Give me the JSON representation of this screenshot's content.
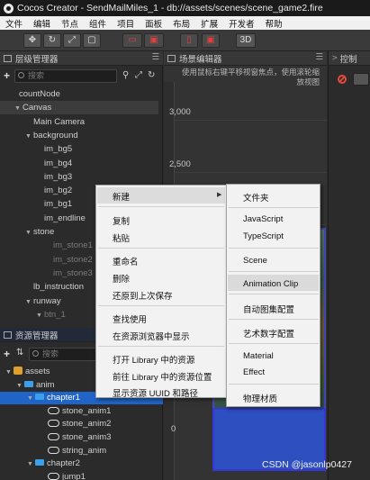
{
  "window": {
    "title": "Cocos Creator - SendMailMiles_1 - db://assets/scenes/scene_game2.fire"
  },
  "menu": [
    "文件",
    "编辑",
    "节点",
    "组件",
    "项目",
    "面板",
    "布局",
    "扩展",
    "开发者",
    "帮助"
  ],
  "toolbar": {
    "mode_3d": "3D"
  },
  "hierarchy": {
    "title": "层级管理器",
    "search_placeholder": "搜索",
    "items": [
      {
        "label": "countNode",
        "depth": 0,
        "arrow": "",
        "dim": false
      },
      {
        "label": "Canvas",
        "depth": 0,
        "arrow": "▼",
        "dim": false
      },
      {
        "label": "Main Camera",
        "depth": 1,
        "arrow": "",
        "dim": false
      },
      {
        "label": "background",
        "depth": 1,
        "arrow": "▼",
        "dim": false
      },
      {
        "label": "im_bg5",
        "depth": 2,
        "arrow": "",
        "dim": false
      },
      {
        "label": "im_bg4",
        "depth": 2,
        "arrow": "",
        "dim": false
      },
      {
        "label": "im_bg3",
        "depth": 2,
        "arrow": "",
        "dim": false
      },
      {
        "label": "im_bg2",
        "depth": 2,
        "arrow": "",
        "dim": false
      },
      {
        "label": "im_bg1",
        "depth": 2,
        "arrow": "",
        "dim": false
      },
      {
        "label": "im_endline",
        "depth": 2,
        "arrow": "",
        "dim": false
      },
      {
        "label": "stone",
        "depth": 1,
        "arrow": "▼",
        "dim": false
      },
      {
        "label": "im_stone1",
        "depth": 2,
        "arrow": "",
        "dim": true
      },
      {
        "label": "im_stone2",
        "depth": 2,
        "arrow": "",
        "dim": true
      },
      {
        "label": "im_stone3",
        "depth": 2,
        "arrow": "",
        "dim": true
      },
      {
        "label": "lb_instruction",
        "depth": 1,
        "arrow": "",
        "dim": false
      },
      {
        "label": "runway",
        "depth": 1,
        "arrow": "▼",
        "dim": false
      },
      {
        "label": "btn_1",
        "depth": 2,
        "arrow": "▼",
        "dim": true
      }
    ]
  },
  "scene": {
    "title": "场景编辑器",
    "hint_line1": "使用鼠标右键平移视窗焦点，使用滚轮缩",
    "hint_line2": "放视图",
    "y_labels": [
      "3,000",
      "2,500",
      "0"
    ]
  },
  "console": {
    "title": "控制"
  },
  "assets": {
    "title": "资源管理器",
    "search_placeholder": "搜索",
    "items": [
      {
        "label": "assets",
        "icon": "db",
        "arrow": "▼",
        "depth": 0,
        "selected": false
      },
      {
        "label": "anim",
        "icon": "folder",
        "arrow": "▼",
        "depth": 1,
        "selected": false
      },
      {
        "label": "chapter1",
        "icon": "folder",
        "arrow": "▼",
        "depth": 2,
        "selected": true
      },
      {
        "label": "stone_anim1",
        "icon": "anim",
        "arrow": "",
        "depth": 3,
        "selected": false
      },
      {
        "label": "stone_anim2",
        "icon": "anim",
        "arrow": "",
        "depth": 3,
        "selected": false
      },
      {
        "label": "stone_anim3",
        "icon": "anim",
        "arrow": "",
        "depth": 3,
        "selected": false
      },
      {
        "label": "string_anim",
        "icon": "anim",
        "arrow": "",
        "depth": 3,
        "selected": false
      },
      {
        "label": "chapter2",
        "icon": "folder",
        "arrow": "▼",
        "depth": 2,
        "selected": false
      },
      {
        "label": "jump1",
        "icon": "anim",
        "arrow": "",
        "depth": 3,
        "selected": false
      }
    ]
  },
  "context_menu": {
    "items": [
      "新建",
      "复制",
      "粘贴",
      "重命名",
      "删除",
      "还原到上次保存",
      "查找使用",
      "在资源浏览器中显示",
      "打开 Library 中的资源",
      "前往 Library 中的资源位置",
      "显示资源 UUID 和路径"
    ],
    "submenu_arrow": "▶"
  },
  "submenu": {
    "items": [
      "文件夹",
      "JavaScript",
      "TypeScript",
      "Scene",
      "Animation Clip",
      "自动图集配置",
      "艺术数字配置",
      "Material",
      "Effect",
      "物理材质"
    ]
  },
  "watermark": "CSDN @jasonlp0427"
}
